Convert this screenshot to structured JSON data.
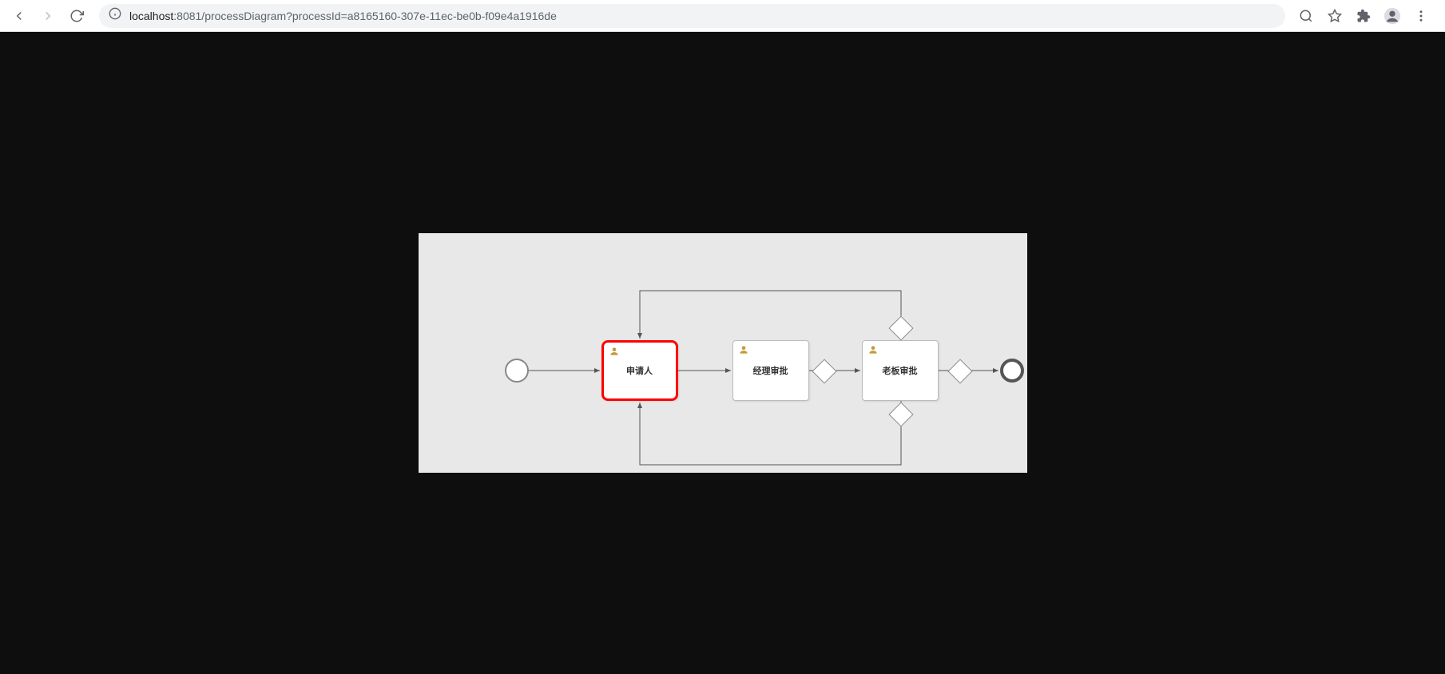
{
  "browser": {
    "url_host": "localhost",
    "url_path": ":8081/processDiagram?processId=a8165160-307e-11ec-be0b-f09e4a1916de"
  },
  "diagram": {
    "tasks": [
      {
        "label": "申请人",
        "active": true
      },
      {
        "label": "经理审批",
        "active": false
      },
      {
        "label": "老板审批",
        "active": false
      }
    ]
  }
}
